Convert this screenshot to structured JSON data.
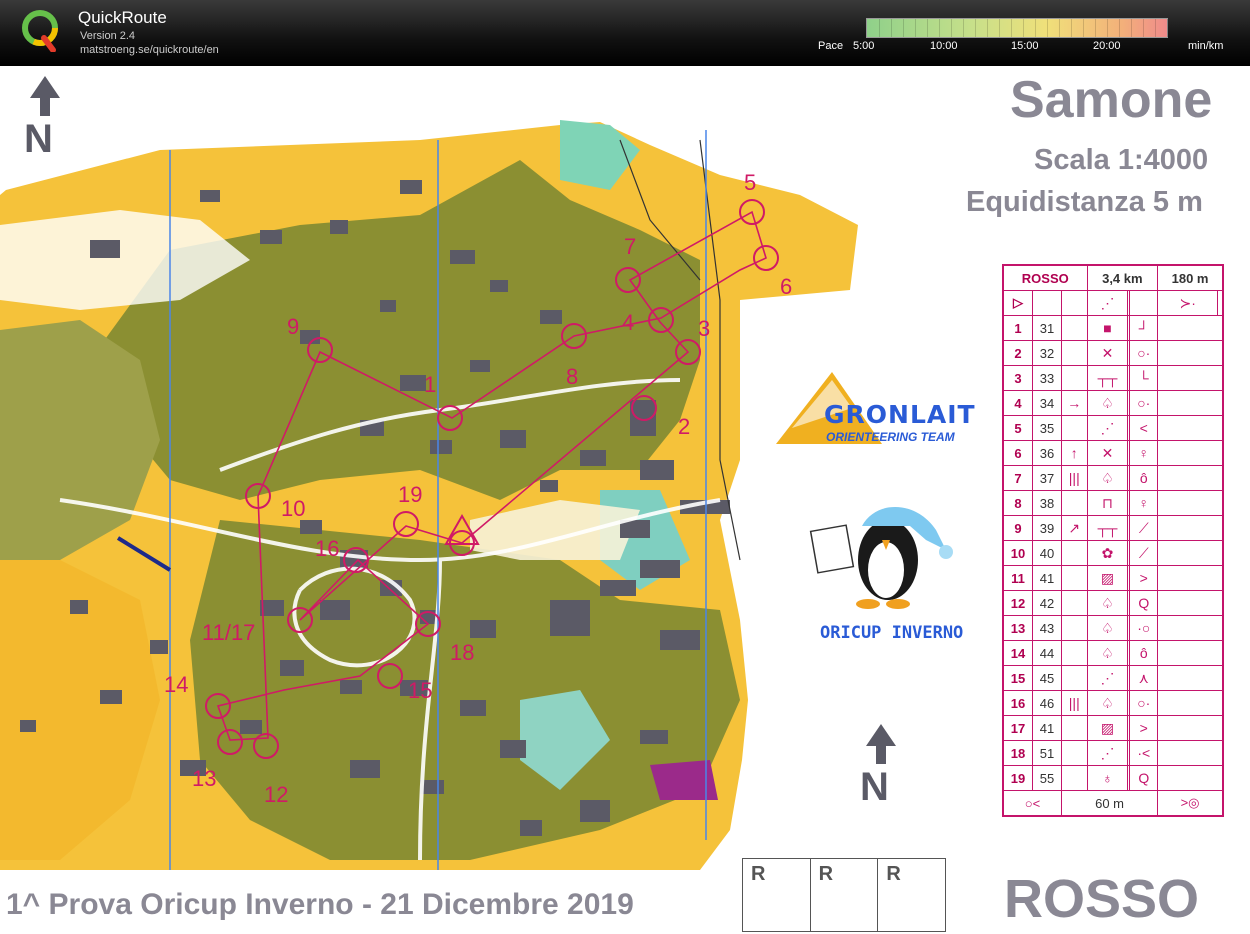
{
  "app": {
    "name": "QuickRoute",
    "version": "Version 2.4",
    "url": "matstroeng.se/quickroute/en"
  },
  "pace_legend": {
    "label": "Pace",
    "ticks": [
      "5:00",
      "10:00",
      "15:00",
      "20:00"
    ],
    "unit": "min/km"
  },
  "map": {
    "title": "Samone",
    "scale": "Scala 1:4000",
    "equidistance": "Equidistanza 5 m",
    "footer": "1^ Prova Oricup Inverno - 21 Dicembre 2019",
    "course_big": "ROSSO",
    "sponsor1_name": "GRONLAIT",
    "sponsor1_sub": "ORIENTEERING TEAM",
    "sponsor2_name": "ORICUP INVERNO",
    "rrr": [
      "R",
      "R",
      "R"
    ],
    "control_labels": [
      "1",
      "2",
      "3",
      "4",
      "5",
      "6",
      "7",
      "8",
      "9",
      "10",
      "11/17",
      "12",
      "13",
      "14",
      "15",
      "16",
      "18",
      "19"
    ],
    "colors": {
      "open": "#f7c531",
      "forest": "#8a8f33",
      "building": "#555562",
      "course": "#d01a66",
      "grid": "#4a86e8"
    }
  },
  "description_sheet": {
    "course": "ROSSO",
    "length": "3,4 km",
    "climb": "180 m",
    "footer_distance": "60 m",
    "rows": [
      {
        "num": "1",
        "code": "31",
        "c3": "",
        "c4": "■",
        "c5": "",
        "c6": "┘",
        "c7": ""
      },
      {
        "num": "2",
        "code": "32",
        "c3": "",
        "c4": "✕",
        "c5": "",
        "c6": "○·",
        "c7": ""
      },
      {
        "num": "3",
        "code": "33",
        "c3": "",
        "c4": "┬┬",
        "c5": "",
        "c6": "└",
        "c7": ""
      },
      {
        "num": "4",
        "code": "34",
        "c3": "→",
        "c4": "♤",
        "c5": "",
        "c6": "○·",
        "c7": ""
      },
      {
        "num": "5",
        "code": "35",
        "c3": "",
        "c4": "⋰",
        "c5": "",
        "c6": "<",
        "c7": ""
      },
      {
        "num": "6",
        "code": "36",
        "c3": "↑",
        "c4": "✕",
        "c5": "",
        "c6": "♀",
        "c7": ""
      },
      {
        "num": "7",
        "code": "37",
        "c3": "|||",
        "c4": "♤",
        "c5": "",
        "c6": "ô",
        "c7": ""
      },
      {
        "num": "8",
        "code": "38",
        "c3": "",
        "c4": "⊓",
        "c5": "",
        "c6": "♀",
        "c7": ""
      },
      {
        "num": "9",
        "code": "39",
        "c3": "↗",
        "c4": "┬┬",
        "c5": "",
        "c6": "⟋",
        "c7": ""
      },
      {
        "num": "10",
        "code": "40",
        "c3": "",
        "c4": "✿",
        "c5": "",
        "c6": "⟋",
        "c7": ""
      },
      {
        "num": "11",
        "code": "41",
        "c3": "",
        "c4": "▨",
        "c5": "",
        "c6": ">",
        "c7": ""
      },
      {
        "num": "12",
        "code": "42",
        "c3": "",
        "c4": "♤",
        "c5": "",
        "c6": "Q",
        "c7": ""
      },
      {
        "num": "13",
        "code": "43",
        "c3": "",
        "c4": "♤",
        "c5": "",
        "c6": "·○",
        "c7": ""
      },
      {
        "num": "14",
        "code": "44",
        "c3": "",
        "c4": "♤",
        "c5": "",
        "c6": "ô",
        "c7": ""
      },
      {
        "num": "15",
        "code": "45",
        "c3": "",
        "c4": "⋰",
        "c5": "",
        "c6": "⋏",
        "c7": ""
      },
      {
        "num": "16",
        "code": "46",
        "c3": "|||",
        "c4": "♤",
        "c5": "",
        "c6": "○·",
        "c7": ""
      },
      {
        "num": "17",
        "code": "41",
        "c3": "",
        "c4": "▨",
        "c5": "",
        "c6": ">",
        "c7": ""
      },
      {
        "num": "18",
        "code": "51",
        "c3": "",
        "c4": "⋰",
        "c5": "",
        "c6": "·<",
        "c7": ""
      },
      {
        "num": "19",
        "code": "55",
        "c3": "",
        "c4": "♁",
        "c5": "",
        "c6": "Q",
        "c7": ""
      }
    ]
  }
}
